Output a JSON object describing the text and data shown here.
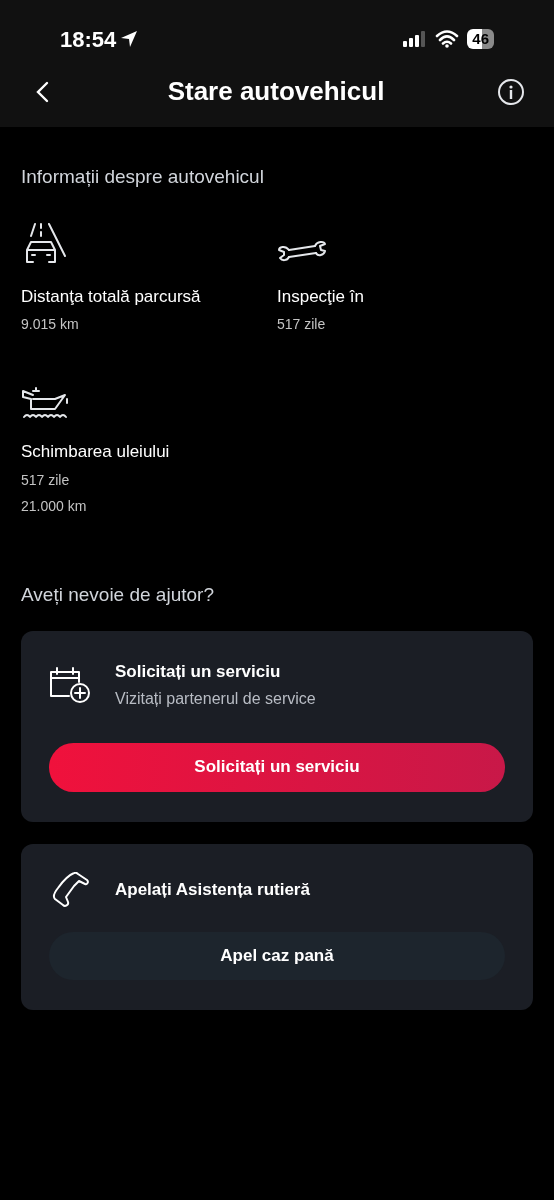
{
  "status_bar": {
    "time": "18:54",
    "battery": "46"
  },
  "header": {
    "title": "Stare autovehicul"
  },
  "vehicle_info": {
    "heading": "Informații despre autovehicul",
    "items": [
      {
        "kind": "road",
        "title": "Distanţa totală parcursă",
        "values": [
          "9.015 km"
        ]
      },
      {
        "kind": "wrench",
        "title": "Inspecţie în",
        "values": [
          "517 zile"
        ]
      },
      {
        "kind": "oil",
        "title": "Schimbarea uleiului",
        "values": [
          "517 zile",
          "21.000 km"
        ]
      }
    ]
  },
  "help": {
    "heading": "Aveți nevoie de ajutor?",
    "cards": [
      {
        "kind": "service",
        "title": "Solicitați un serviciu",
        "subtitle": "Vizitați partenerul de service",
        "button": "Solicitați un serviciu"
      },
      {
        "kind": "roadside",
        "title": "Apelați Asistența rutieră",
        "button": "Apel caz pană"
      }
    ]
  }
}
